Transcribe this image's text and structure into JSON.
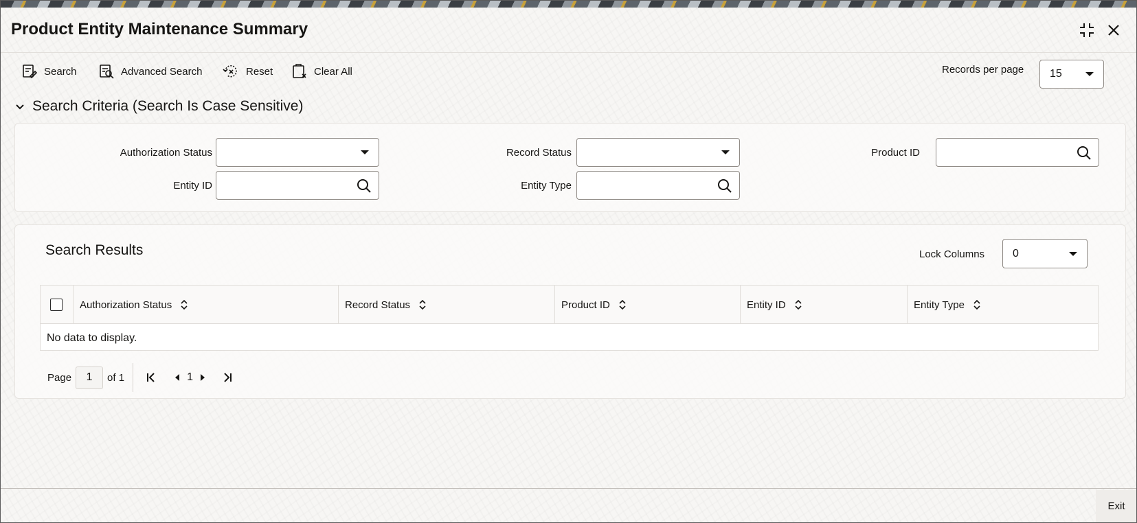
{
  "window": {
    "title": "Product Entity Maintenance Summary"
  },
  "toolbar": {
    "search_label": "Search",
    "advanced_search_label": "Advanced Search",
    "reset_label": "Reset",
    "clear_all_label": "Clear All",
    "records_per_page_label": "Records per page",
    "records_per_page_value": "15"
  },
  "search_criteria": {
    "title": "Search Criteria (Search Is Case Sensitive)",
    "authorization_status_label": "Authorization Status",
    "authorization_status_value": "",
    "record_status_label": "Record Status",
    "record_status_value": "",
    "product_id_label": "Product ID",
    "product_id_value": "",
    "entity_id_label": "Entity ID",
    "entity_id_value": "",
    "entity_type_label": "Entity Type",
    "entity_type_value": ""
  },
  "results": {
    "title": "Search Results",
    "lock_columns_label": "Lock Columns",
    "lock_columns_value": "0",
    "columns": [
      "Authorization Status",
      "Record Status",
      "Product ID",
      "Entity ID",
      "Entity Type"
    ],
    "empty_text": "No data to display."
  },
  "pagination": {
    "page_label": "Page",
    "current_page": "1",
    "of_label": "of 1",
    "page_number": "1"
  },
  "footer": {
    "exit_label": "Exit"
  }
}
